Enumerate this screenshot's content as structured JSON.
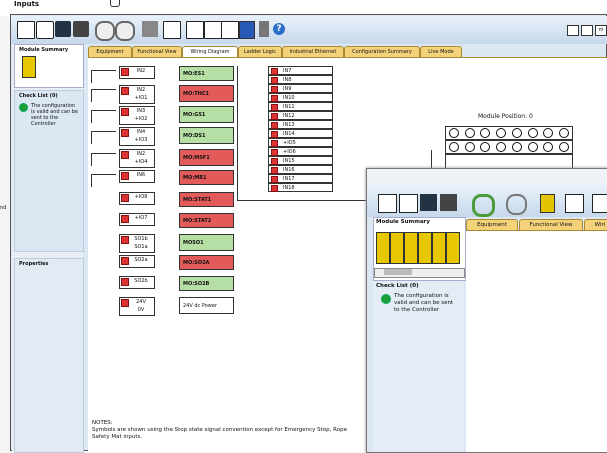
{
  "background_window": {
    "title": "Inputs"
  },
  "toolbar": {
    "help_glyph": "?",
    "nav_label": "m"
  },
  "left_panel": {
    "module_summary_title": "Module Summary",
    "check_list_title": "Check List (0)",
    "check_message": "The configuration is valid and can be sent to the Controller",
    "properties_title": "Properties",
    "edge_text": "nd"
  },
  "tabs": [
    "Equipment",
    "Functional View",
    "Wiring Diagram",
    "Ladder Logic",
    "Industrial Ethernet",
    "Configuration Summary",
    "Live Mode"
  ],
  "active_tab": "Wiring Diagram",
  "wiring": {
    "inputs": [
      {
        "a": "IN2",
        "b": "",
        "output": "MO:ES1",
        "out_color": "green"
      },
      {
        "a": "IN2",
        "b": "+IO1",
        "output": "MO:THC1",
        "out_color": "red"
      },
      {
        "a": "IN3",
        "b": "+IO2",
        "output": "MO:GS1",
        "out_color": "green"
      },
      {
        "a": "IN4",
        "b": "+IO3",
        "output": "MO:DS1",
        "out_color": "green"
      },
      {
        "a": "IN2",
        "b": "+IO4",
        "output": "MO:MSF1",
        "out_color": "red"
      },
      {
        "a": "IN6",
        "b": "",
        "output": "MO:MR1",
        "out_color": "red"
      },
      {
        "a": "+IO8",
        "b": "",
        "output": "MO:STAT1",
        "out_color": "red"
      },
      {
        "a": "+IO7",
        "b": "",
        "output": "MO:STAT2",
        "out_color": "red"
      },
      {
        "a": "SO1b",
        "b": "SO1a",
        "output": "MOSO1",
        "out_color": "green"
      },
      {
        "a": "SO2a",
        "b": "",
        "output": "MO:SO2A",
        "out_color": "red"
      },
      {
        "a": "SO2b",
        "b": "",
        "output": "MO:SO2B",
        "out_color": "green"
      },
      {
        "a": "24V",
        "b": "0V",
        "output": "24V dc Power",
        "out_color": "white"
      }
    ],
    "terminal_column": [
      "IN7",
      "IN8",
      "IN9",
      "IN10",
      "IN11",
      "IN12",
      "IN13",
      "IN14",
      "+IO5",
      "+IO6",
      "IN15",
      "IN16",
      "IN17",
      "IN18"
    ],
    "module_position": "Module Position: 0",
    "notes_title": "NOTES:",
    "notes_text": "Symbols are shown using the Stop state signal convention except for Emergency Stop, Rope",
    "notes_text2": "Safety Mat inputs."
  },
  "popup": {
    "module_summary_title": "Module Summary",
    "check_list_title": "Check List (0)",
    "check_message": "The configuration is valid and can be sent to the Controller",
    "tabs": [
      "Equipment",
      "Functional View",
      "Wiri"
    ]
  }
}
